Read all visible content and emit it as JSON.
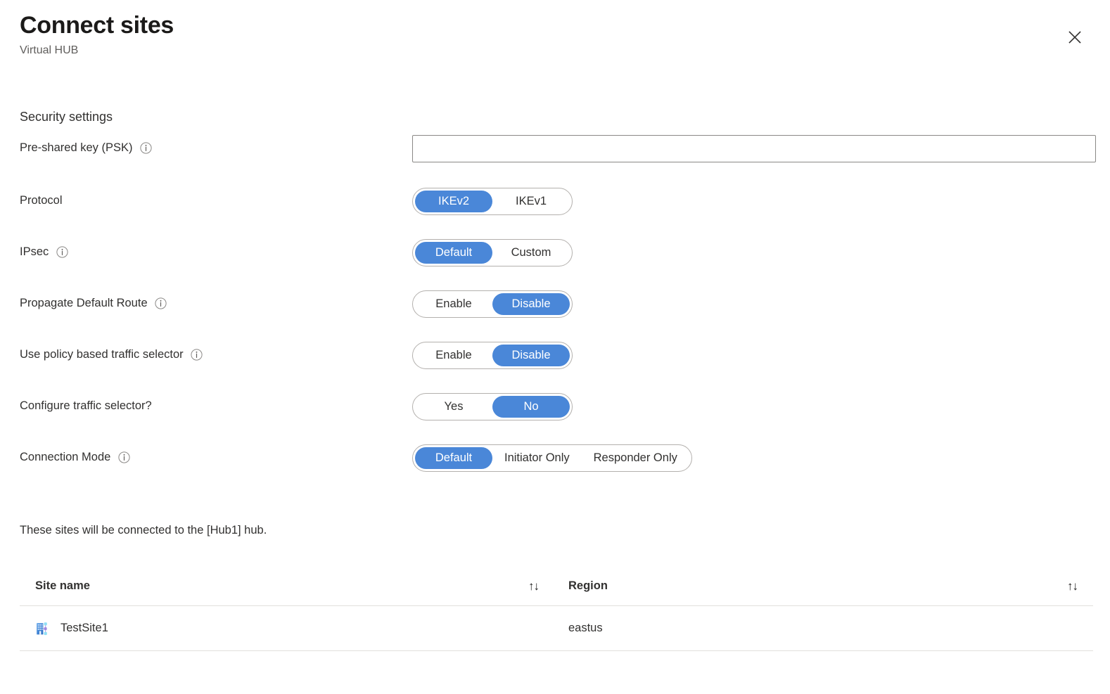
{
  "header": {
    "title": "Connect sites",
    "subtitle": "Virtual HUB",
    "close_label": "Close",
    "close_icon": "close-icon"
  },
  "form": {
    "section_heading": "Security settings",
    "psk": {
      "label": "Pre-shared key (PSK)",
      "info_icon": "info-icon",
      "value": "",
      "placeholder": ""
    },
    "protocol": {
      "label": "Protocol",
      "options": [
        "IKEv2",
        "IKEv1"
      ],
      "selected": "IKEv2"
    },
    "ipsec": {
      "label": "IPsec",
      "info_icon": "info-icon",
      "options": [
        "Default",
        "Custom"
      ],
      "selected": "Default"
    },
    "propagate_default_route": {
      "label": "Propagate Default Route",
      "info_icon": "info-icon",
      "options": [
        "Enable",
        "Disable"
      ],
      "selected": "Disable"
    },
    "policy_based_traffic_selector": {
      "label": "Use policy based traffic selector",
      "info_icon": "info-icon",
      "options": [
        "Enable",
        "Disable"
      ],
      "selected": "Disable"
    },
    "configure_traffic_selector": {
      "label": "Configure traffic selector?",
      "options": [
        "Yes",
        "No"
      ],
      "selected": "No"
    },
    "connection_mode": {
      "label": "Connection Mode",
      "info_icon": "info-icon",
      "options": [
        "Default",
        "Initiator Only",
        "Responder Only"
      ],
      "selected": "Default"
    }
  },
  "note": "These sites will be connected to the [Hub1] hub.",
  "table": {
    "columns": [
      {
        "label": "Site name",
        "sort_icon": "sort-arrows-icon"
      },
      {
        "label": "Region",
        "sort_icon": "sort-arrows-icon"
      }
    ],
    "sort_glyph": "↑↓",
    "rows": [
      {
        "site_name": "TestSite1",
        "region": "eastus",
        "icon": "site-building-network-icon"
      }
    ]
  },
  "colors": {
    "accent_blue": "#4a87d8",
    "text_primary": "#323130",
    "text_secondary": "#605e5c",
    "border": "#b3b0ad",
    "input_border": "#8a8886",
    "table_border": "#e1dfdd"
  }
}
